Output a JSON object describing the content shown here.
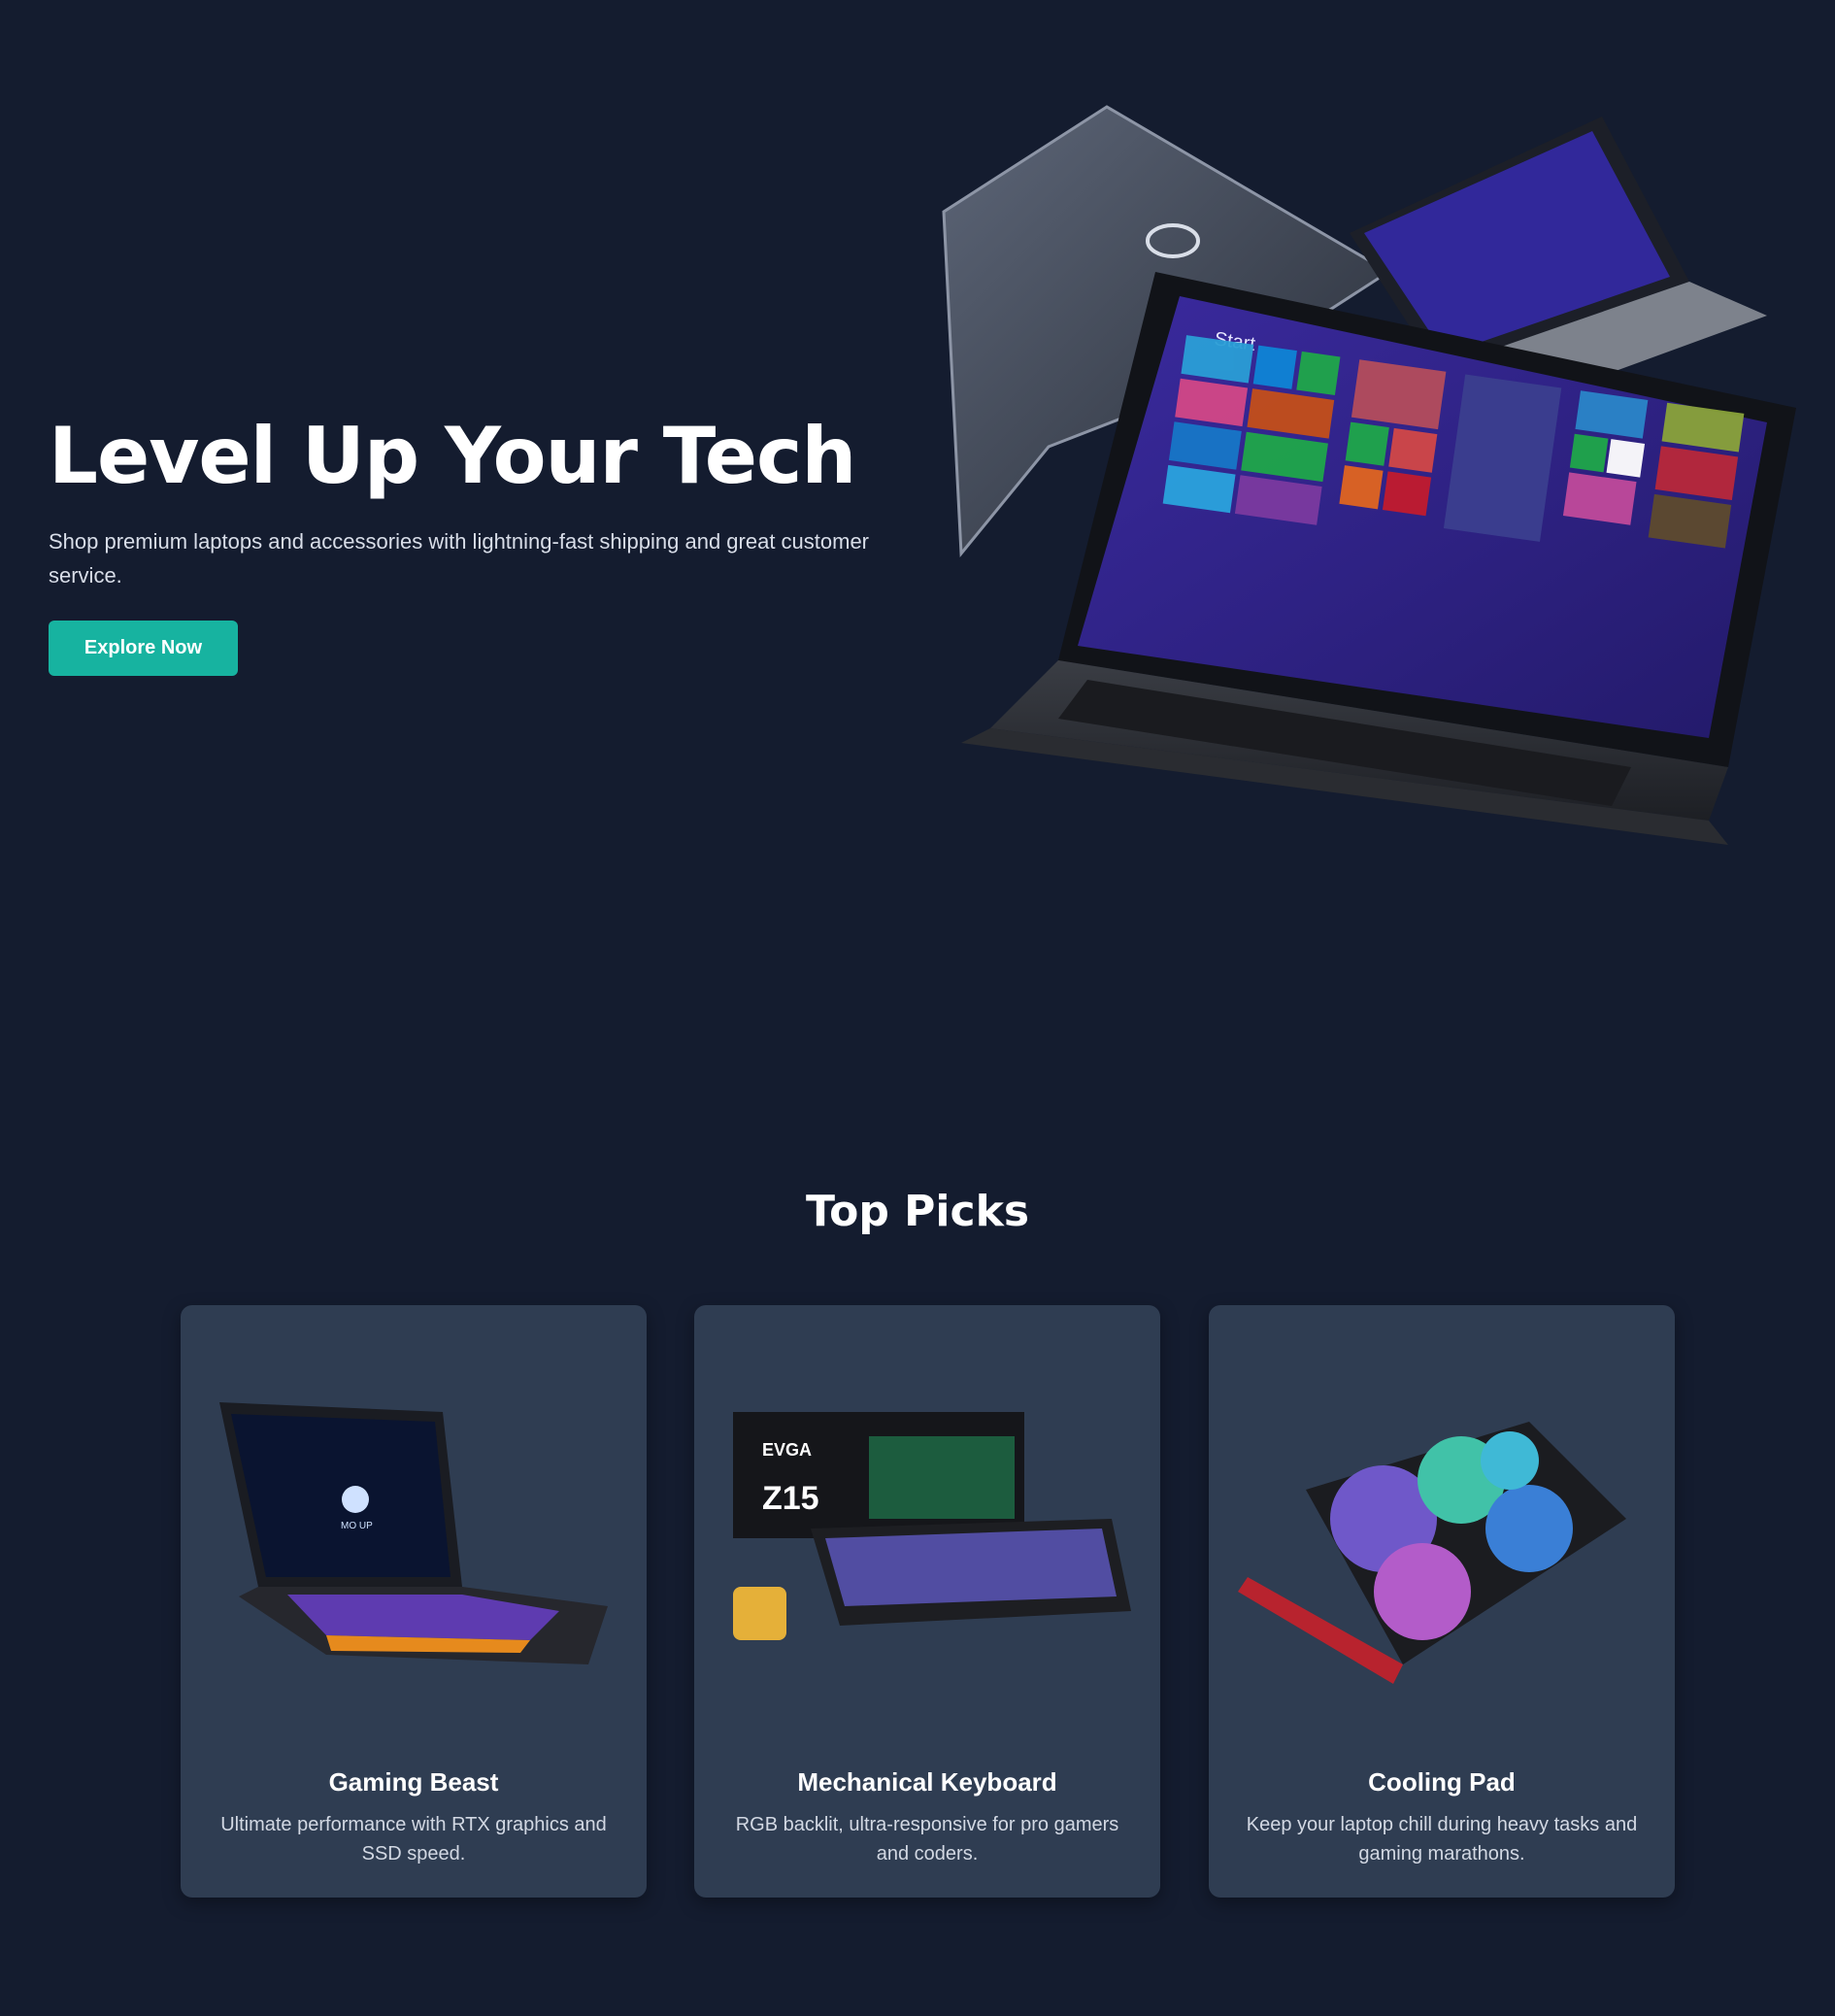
{
  "hero": {
    "title": "Level Up Your Tech",
    "subtitle": "Shop premium laptops and accessories with lightning-fast shipping and great customer service.",
    "cta_label": "Explore Now",
    "image_icon": "laptops-hero-image"
  },
  "top_picks": {
    "title": "Top Picks",
    "cards": [
      {
        "title": "Gaming Beast",
        "description": "Ultimate performance with RTX graphics and SSD speed.",
        "image_icon": "gaming-laptop-image"
      },
      {
        "title": "Mechanical Keyboard",
        "description": "RGB backlit, ultra-responsive for pro gamers and coders.",
        "image_icon": "keyboard-image"
      },
      {
        "title": "Cooling Pad",
        "description": "Keep your laptop chill during heavy tasks and gaming marathons.",
        "image_icon": "cooling-pad-image"
      }
    ]
  },
  "colors": {
    "background": "#141c2f",
    "card": "#2f3d52",
    "accent": "#17b3a0"
  }
}
